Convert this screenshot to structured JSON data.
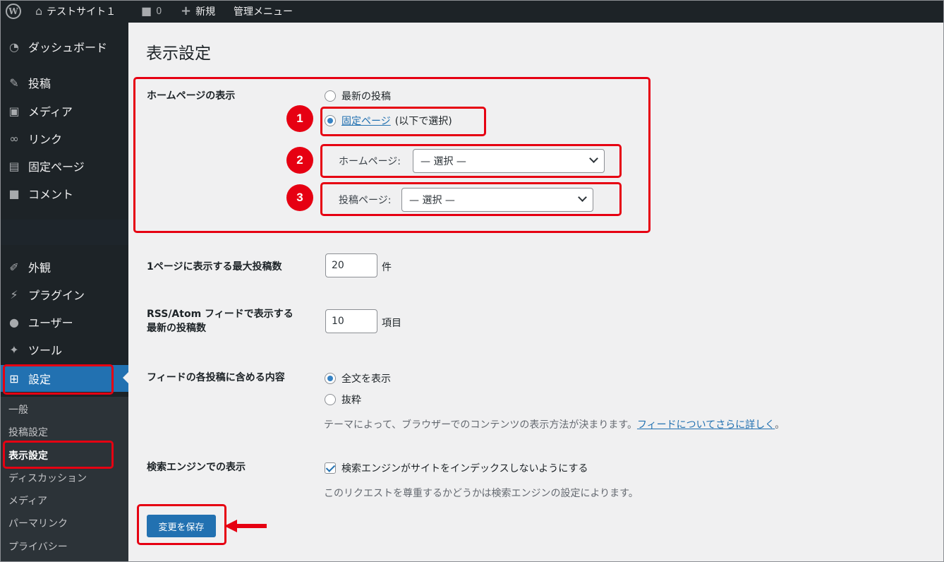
{
  "adminbar": {
    "site_name": "テストサイト１",
    "comments_count": "0",
    "new_label": "新規",
    "admin_menu_label": "管理メニュー"
  },
  "sidebar": {
    "items": [
      {
        "label": "ダッシュボード",
        "icon": "dashboard-icon"
      },
      {
        "label": "投稿",
        "icon": "pin-icon"
      },
      {
        "label": "メディア",
        "icon": "media-icon"
      },
      {
        "label": "リンク",
        "icon": "link-icon"
      },
      {
        "label": "固定ページ",
        "icon": "page-icon"
      },
      {
        "label": "コメント",
        "icon": "comment-icon"
      },
      {
        "label": "外観",
        "icon": "brush-icon"
      },
      {
        "label": "プラグイン",
        "icon": "plugin-icon"
      },
      {
        "label": "ユーザー",
        "icon": "user-icon"
      },
      {
        "label": "ツール",
        "icon": "wrench-icon"
      },
      {
        "label": "設定",
        "icon": "settings-icon"
      }
    ],
    "submenu": [
      "一般",
      "投稿設定",
      "表示設定",
      "ディスカッション",
      "メディア",
      "パーマリンク",
      "プライバシー"
    ]
  },
  "main": {
    "title": "表示設定",
    "homepage": {
      "label": "ホームページの表示",
      "option_latest": "最新の投稿",
      "option_static_link": "固定ページ",
      "option_static_suffix": "(以下で選択)",
      "homepage_label": "ホームページ:",
      "homepage_value": "— 選択 —",
      "postspage_label": "投稿ページ:",
      "postspage_value": "— 選択 —"
    },
    "posts_per_page": {
      "label": "1ページに表示する最大投稿数",
      "value": "20",
      "unit": "件"
    },
    "rss": {
      "label_line1": "RSS/Atom フィードで表示する",
      "label_line2": "最新の投稿数",
      "value": "10",
      "unit": "項目"
    },
    "feed_content": {
      "label": "フィードの各投稿に含める内容",
      "option_full": "全文を表示",
      "option_excerpt": "抜粋",
      "desc_prefix": "テーマによって、ブラウザーでのコンテンツの表示方法が決まります。",
      "desc_link": "フィードについてさらに詳しく",
      "desc_suffix": "。"
    },
    "search_engine": {
      "label": "検索エンジンでの表示",
      "checkbox_label": "検索エンジンがサイトをインデックスしないようにする",
      "desc": "このリクエストを尊重するかどうかは検索エンジンの設定によります。"
    },
    "save_label": "変更を保存"
  },
  "annotations": {
    "badge1": "1",
    "badge2": "2",
    "badge3": "3"
  },
  "colors": {
    "accent": "#2271b1",
    "sidebar": "#1d2327",
    "annotation": "#e60012"
  }
}
